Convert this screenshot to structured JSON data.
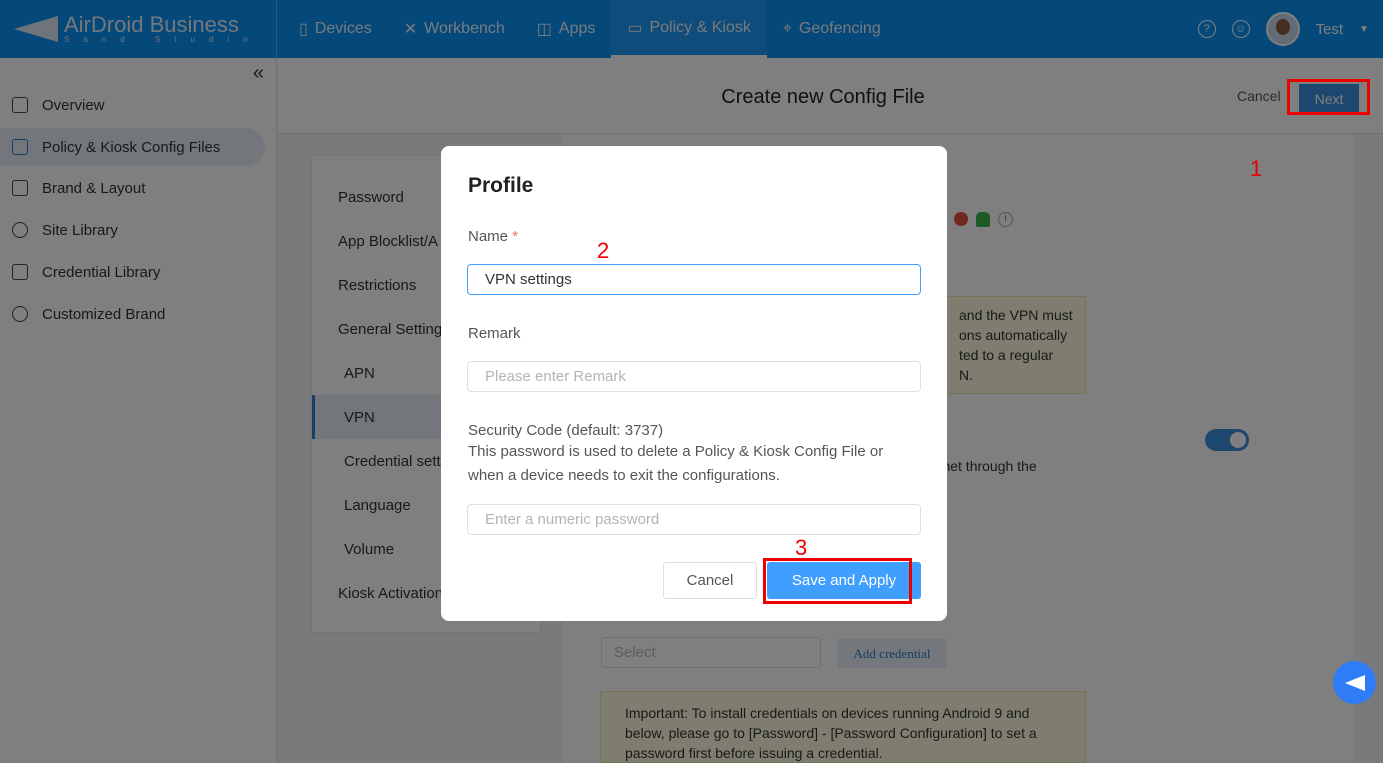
{
  "header": {
    "logo_text": "AirDroid Business",
    "logo_sub": "Sand Studio",
    "nav": [
      {
        "label": "Devices",
        "icon": "phone-icon"
      },
      {
        "label": "Workbench",
        "icon": "tools-icon"
      },
      {
        "label": "Apps",
        "icon": "bag-icon"
      },
      {
        "label": "Policy & Kiosk",
        "icon": "folder-icon",
        "active": true
      },
      {
        "label": "Geofencing",
        "icon": "map-pin-icon"
      }
    ],
    "user_name": "Test"
  },
  "sidebar": {
    "items": [
      {
        "label": "Overview"
      },
      {
        "label": "Policy & Kiosk Config Files",
        "active": true
      },
      {
        "label": "Brand & Layout"
      },
      {
        "label": "Site Library"
      },
      {
        "label": "Credential Library"
      },
      {
        "label": "Customized Brand"
      }
    ]
  },
  "topbar": {
    "title": "Create new Config File",
    "cancel": "Cancel",
    "next": "Next"
  },
  "config_menu": [
    {
      "label": "Password"
    },
    {
      "label": "App Blocklist/A"
    },
    {
      "label": "Restrictions"
    },
    {
      "label": "General Setting"
    },
    {
      "label": "APN",
      "sub": true
    },
    {
      "label": "VPN",
      "sub": true,
      "active": true
    },
    {
      "label": "Credential setti",
      "sub": true
    },
    {
      "label": "Language",
      "sub": true
    },
    {
      "label": "Volume",
      "sub": true
    },
    {
      "label": "Kiosk Activation"
    }
  ],
  "content": {
    "notice1": [
      "and the VPN must",
      "ons automatically",
      "ted to a regular",
      "N."
    ],
    "toggle_text": "ernet through the",
    "toggle_on": true,
    "select_placeholder": "Select",
    "add_credential": "Add credential",
    "notice2": "Important: To install credentials on devices running Android 9 and below, please go to [Password] - [Password Configuration] to set a password first before issuing a credential."
  },
  "modal": {
    "title": "Profile",
    "name_label": "Name",
    "name_value": "VPN settings",
    "remark_label": "Remark",
    "remark_placeholder": "Please enter Remark",
    "security_label": "Security Code (default: 3737)",
    "security_desc": "This password is used to delete a Policy & Kiosk Config File or when a device needs to exit the configurations.",
    "security_placeholder": "Enter a numeric password",
    "cancel": "Cancel",
    "save": "Save and Apply"
  },
  "annotations": [
    "1",
    "2",
    "3"
  ],
  "colors": {
    "header": "#0a92f6",
    "primary": "#409eff",
    "annotation": "#ee0000"
  }
}
